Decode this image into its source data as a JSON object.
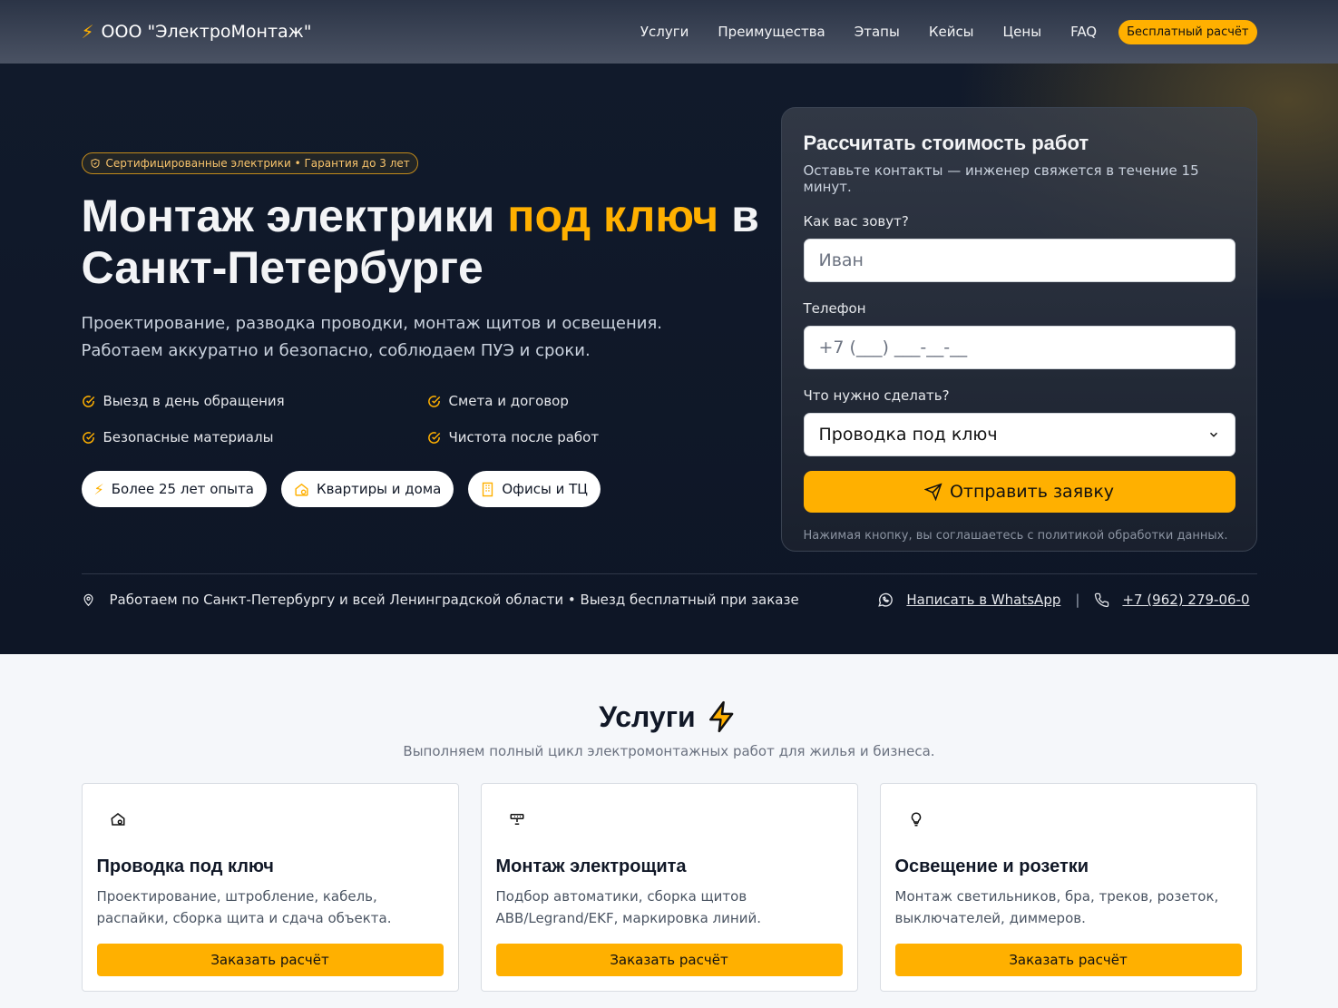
{
  "nav": {
    "brand": "ООО \"ЭлектроМонтаж\"",
    "links": [
      "Услуги",
      "Преимущества",
      "Этапы",
      "Кейсы",
      "Цены",
      "FAQ"
    ],
    "cta": "Бесплатный расчёт"
  },
  "hero": {
    "badge": "Сертифицированные электрики • Гарантия до 3 лет",
    "title_part1": "Монтаж электрики ",
    "title_accent": "под ключ",
    "title_part2": " в Санкт-Петербурге",
    "lead": "Проектирование, разводка проводки, монтаж щитов и освещения. Работаем аккуратно и безопасно, соблюдаем ПУЭ и сроки.",
    "checks": [
      "Выезд в день обращения",
      "Смета и договор",
      "Безопасные материалы",
      "Чистота после работ"
    ],
    "pills": [
      "Более 25 лет опыта",
      "Квартиры и дома",
      "Офисы и ТЦ"
    ],
    "location": "Работаем по Санкт-Петербургу и всей Ленинградской области • Выезд бесплатный при заказе",
    "whatsapp": "Написать в WhatsApp",
    "separator": "|",
    "phone": "+7 (962) 279-06-0"
  },
  "form": {
    "title": "Рассчитать стоимость работ",
    "subtitle": "Оставьте контакты — инженер свяжется в течение 15 минут.",
    "name_label": "Как вас зовут?",
    "name_placeholder": "Иван",
    "phone_label": "Телефон",
    "phone_placeholder": "+7 (___) ___-__-__",
    "task_label": "Что нужно сделать?",
    "task_value": "Проводка под ключ",
    "submit": "Отправить заявку",
    "consent": "Нажимая кнопку, вы соглашаетесь с политикой обработки данных."
  },
  "services": {
    "title": "Услуги",
    "subtitle": "Выполняем полный цикл электромонтажных работ для жилья и бизнеса.",
    "cards": [
      {
        "title": "Проводка под ключ",
        "text": "Проектирование, штробление, кабель, распайки, сборка щита и сдача объекта.",
        "button": "Заказать расчёт",
        "icon": "house-gear-icon"
      },
      {
        "title": "Монтаж электрощита",
        "text": "Подбор автоматики, сборка щитов ABB/Legrand/EKF, маркировка линий.",
        "button": "Заказать расчёт",
        "icon": "panel-icon"
      },
      {
        "title": "Освещение и розетки",
        "text": "Монтаж светильников, бра, треков, розеток, выключателей, диммеров.",
        "button": "Заказать расчёт",
        "icon": "lightbulb-icon"
      }
    ]
  },
  "colors": {
    "accent": "#ffb000",
    "hero_bg": "#111a2b"
  }
}
